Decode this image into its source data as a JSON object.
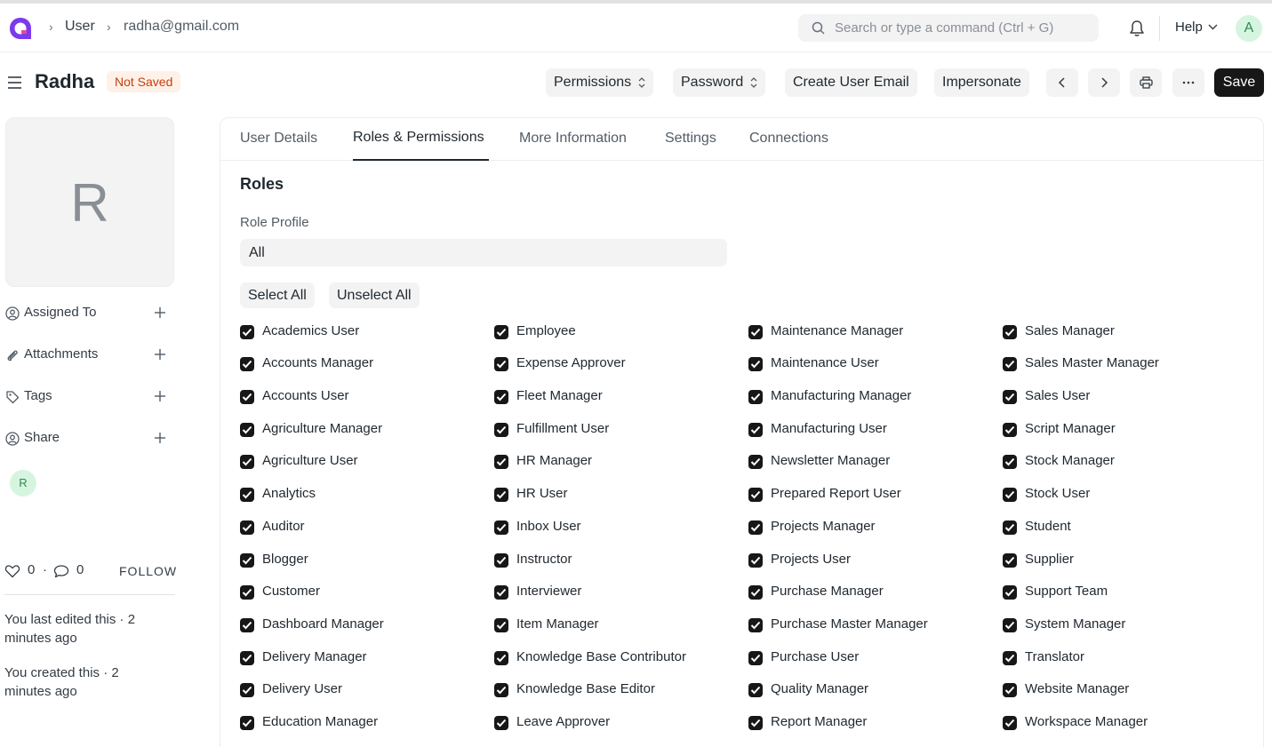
{
  "nav": {
    "breadcrumbs": [
      "User",
      "radha@gmail.com"
    ],
    "search_placeholder": "Search or type a command (Ctrl + G)",
    "help_label": "Help",
    "user_initial": "A"
  },
  "header": {
    "title": "Radha",
    "status_badge": "Not Saved",
    "buttons": {
      "permissions": "Permissions",
      "password": "Password",
      "create_user_email": "Create User Email",
      "impersonate": "Impersonate",
      "save": "Save"
    }
  },
  "sidebar": {
    "avatar_initial": "R",
    "items": [
      {
        "label": "Assigned To",
        "icon": "assign-icon"
      },
      {
        "label": "Attachments",
        "icon": "paperclip-icon"
      },
      {
        "label": "Tags",
        "icon": "tag-icon"
      },
      {
        "label": "Share",
        "icon": "share-icon"
      }
    ],
    "shared_user_initial": "R",
    "likes_count": "0",
    "comments_count": "0",
    "follow_label": "FOLLOW",
    "activity": [
      "You last edited this · 2 minutes ago",
      "You created this · 2 minutes ago"
    ]
  },
  "tabs": [
    "User Details",
    "Roles & Permissions",
    "More Information",
    "Settings",
    "Connections"
  ],
  "active_tab": "Roles & Permissions",
  "roles_section": {
    "title": "Roles",
    "role_profile_label": "Role Profile",
    "role_profile_value": "All",
    "select_all": "Select All",
    "unselect_all": "Unselect All",
    "columns": [
      [
        "Academics User",
        "Accounts Manager",
        "Accounts User",
        "Agriculture Manager",
        "Agriculture User",
        "Analytics",
        "Auditor",
        "Blogger",
        "Customer",
        "Dashboard Manager",
        "Delivery Manager",
        "Delivery User",
        "Education Manager"
      ],
      [
        "Employee",
        "Expense Approver",
        "Fleet Manager",
        "Fulfillment User",
        "HR Manager",
        "HR User",
        "Inbox User",
        "Instructor",
        "Interviewer",
        "Item Manager",
        "Knowledge Base Contributor",
        "Knowledge Base Editor",
        "Leave Approver"
      ],
      [
        "Maintenance Manager",
        "Maintenance User",
        "Manufacturing Manager",
        "Manufacturing User",
        "Newsletter Manager",
        "Prepared Report User",
        "Projects Manager",
        "Projects User",
        "Purchase Manager",
        "Purchase Master Manager",
        "Purchase User",
        "Quality Manager",
        "Report Manager"
      ],
      [
        "Sales Manager",
        "Sales Master Manager",
        "Sales User",
        "Script Manager",
        "Stock Manager",
        "Stock User",
        "Student",
        "Supplier",
        "Support Team",
        "System Manager",
        "Translator",
        "Website Manager",
        "Workspace Manager"
      ]
    ],
    "all_checked": true
  }
}
